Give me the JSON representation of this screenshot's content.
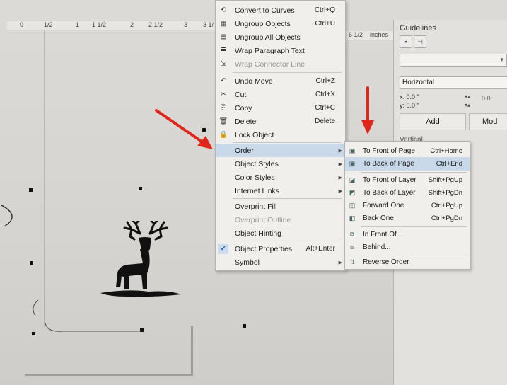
{
  "ruler": {
    "ticks": [
      "0",
      "1/2",
      "1",
      "1 1/2",
      "2",
      "2 1/2",
      "3",
      "3 1/"
    ],
    "right_ticks": [
      "6 1/2",
      "inches"
    ]
  },
  "menu": {
    "items": [
      {
        "icon": "convert-curves-icon",
        "glyph": "⟲",
        "label": "Convert to Curves",
        "shortcut": "Ctrl+Q"
      },
      {
        "icon": "ungroup-icon",
        "glyph": "▦",
        "label": "Ungroup Objects",
        "shortcut": "Ctrl+U"
      },
      {
        "icon": "ungroup-all-icon",
        "glyph": "▤",
        "label": "Ungroup All Objects",
        "shortcut": ""
      },
      {
        "icon": "wrap-paragraph-icon",
        "glyph": "≣",
        "label": "Wrap Paragraph Text",
        "shortcut": ""
      },
      {
        "icon": "wrap-connector-icon",
        "glyph": "⇲",
        "label": "Wrap Connector Line",
        "shortcut": ""
      },
      {
        "icon": "undo-icon",
        "glyph": "↶",
        "label": "Undo Move",
        "shortcut": "Ctrl+Z"
      },
      {
        "icon": "cut-icon",
        "glyph": "✂",
        "label": "Cut",
        "shortcut": "Ctrl+X"
      },
      {
        "icon": "copy-icon",
        "glyph": "⎘",
        "label": "Copy",
        "shortcut": "Ctrl+C"
      },
      {
        "icon": "delete-icon",
        "glyph": "🗑",
        "label": "Delete",
        "shortcut": "Delete"
      },
      {
        "icon": "lock-icon",
        "glyph": "🔒",
        "label": "Lock Object",
        "shortcut": ""
      },
      {
        "icon": "",
        "glyph": "",
        "label": "Order",
        "shortcut": ""
      },
      {
        "icon": "",
        "glyph": "",
        "label": "Object Styles",
        "shortcut": ""
      },
      {
        "icon": "",
        "glyph": "",
        "label": "Color Styles",
        "shortcut": ""
      },
      {
        "icon": "",
        "glyph": "",
        "label": "Internet Links",
        "shortcut": ""
      },
      {
        "icon": "",
        "glyph": "",
        "label": "Overprint Fill",
        "shortcut": ""
      },
      {
        "icon": "",
        "glyph": "",
        "label": "Overprint Outline",
        "shortcut": ""
      },
      {
        "icon": "",
        "glyph": "",
        "label": "Object Hinting",
        "shortcut": ""
      },
      {
        "icon": "checkmark-icon",
        "glyph": "✓",
        "label": "Object Properties",
        "shortcut": "Alt+Enter"
      },
      {
        "icon": "",
        "glyph": "",
        "label": "Symbol",
        "shortcut": ""
      }
    ]
  },
  "submenu": {
    "items": [
      {
        "icon": "to-front-of-page-icon",
        "glyph": "▣",
        "label": "To Front of Page",
        "shortcut": "Ctrl+Home"
      },
      {
        "icon": "to-back-of-page-icon",
        "glyph": "▣",
        "label": "To Back of Page",
        "shortcut": "Ctrl+End"
      },
      {
        "icon": "to-front-of-layer-icon",
        "glyph": "◪",
        "label": "To Front of Layer",
        "shortcut": "Shift+PgUp"
      },
      {
        "icon": "to-back-of-layer-icon",
        "glyph": "◩",
        "label": "To Back of Layer",
        "shortcut": "Shift+PgDn"
      },
      {
        "icon": "forward-one-icon",
        "glyph": "◫",
        "label": "Forward One",
        "shortcut": "Ctrl+PgUp"
      },
      {
        "icon": "back-one-icon",
        "glyph": "◧",
        "label": "Back One",
        "shortcut": "Ctrl+PgDn"
      },
      {
        "icon": "in-front-of-icon",
        "glyph": "⧉",
        "label": "In Front Of...",
        "shortcut": ""
      },
      {
        "icon": "behind-icon",
        "glyph": "⧈",
        "label": "Behind...",
        "shortcut": ""
      },
      {
        "icon": "reverse-order-icon",
        "glyph": "⇅",
        "label": "Reverse Order",
        "shortcut": ""
      }
    ]
  },
  "docker": {
    "title": "Guidelines",
    "horizontal_label": "Horizontal",
    "x_value": "x: 0.0 \"",
    "y_value": "y: 0.0 \"",
    "angle_value": "0.0",
    "add_label": "Add",
    "modify_label": "Mod",
    "vertical_label": "Vertical"
  },
  "colors": {
    "highlight": "#c9d9ea",
    "annotation_arrow": "#e0261b"
  }
}
